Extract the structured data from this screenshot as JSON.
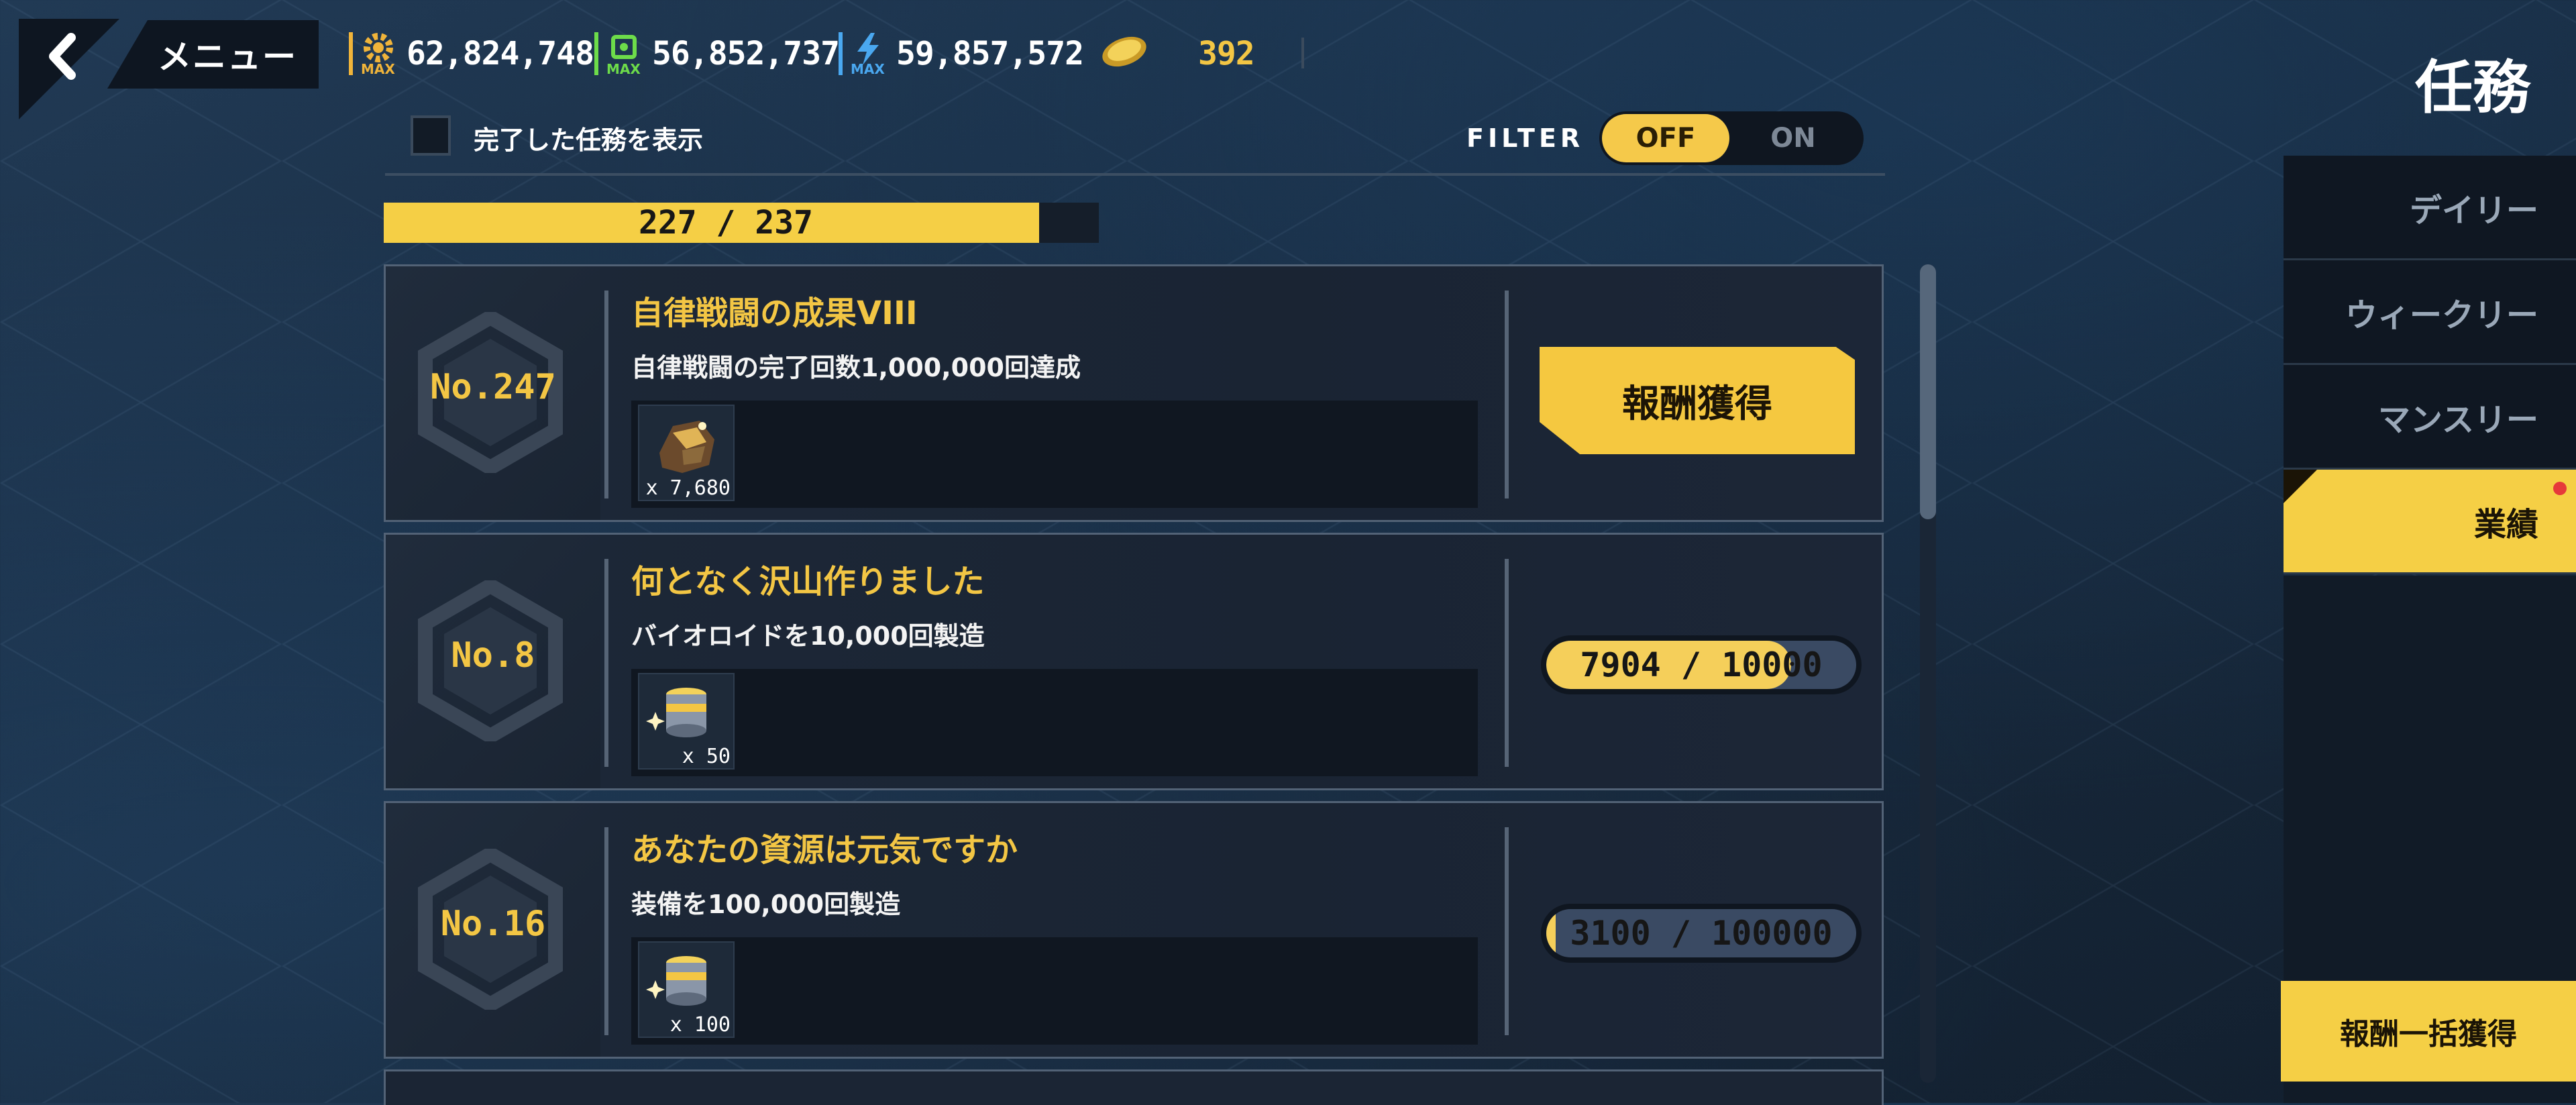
{
  "header": {
    "menu_label": "メニュー",
    "title": "任務",
    "resources": [
      {
        "icon": "gear-icon",
        "badge": "MAX",
        "value": "62,824,748",
        "color": "#f0b43a"
      },
      {
        "icon": "chip-icon",
        "badge": "MAX",
        "value": "56,852,737",
        "color": "#6ddc4a"
      },
      {
        "icon": "energy-icon",
        "badge": "MAX",
        "value": "59,857,572",
        "color": "#4aa8f0"
      },
      {
        "icon": "coin-icon",
        "value": "392",
        "color": "#f3c644"
      }
    ]
  },
  "filter": {
    "show_completed_label": "完了した任務を表示",
    "label": "FILTER",
    "off": "OFF",
    "on": "ON",
    "selected": "OFF"
  },
  "total_progress": {
    "text": "227  /  237",
    "current": 227,
    "total": 237
  },
  "missions": [
    {
      "no": "No.247",
      "name": "自律戦闘の成果VIII",
      "desc": "自律戦闘の完了回数1,000,000回達成",
      "reward_icon": "ore-icon",
      "reward_qty": "x 7,680",
      "state": "claim",
      "claim_label": "報酬獲得"
    },
    {
      "no": "No.8",
      "name": "何となく沢山作りました",
      "desc": "バイオロイドを10,000回製造",
      "reward_icon": "canister-icon",
      "reward_qty": "x 50",
      "state": "progress",
      "progress_text": "7904  /  10000",
      "current": 7904,
      "total": 10000
    },
    {
      "no": "No.16",
      "name": "あなたの資源は元気ですか",
      "desc": "装備を100,000回製造",
      "reward_icon": "canister-icon",
      "reward_qty": "x 100",
      "state": "progress",
      "progress_text": "3100  /  100000",
      "current": 3100,
      "total": 100000
    }
  ],
  "tabs": [
    {
      "label": "デイリー",
      "active": false
    },
    {
      "label": "ウィークリー",
      "active": false
    },
    {
      "label": "マンスリー",
      "active": false
    },
    {
      "label": "業績",
      "active": true
    }
  ],
  "claim_all_label": "報酬一括獲得"
}
